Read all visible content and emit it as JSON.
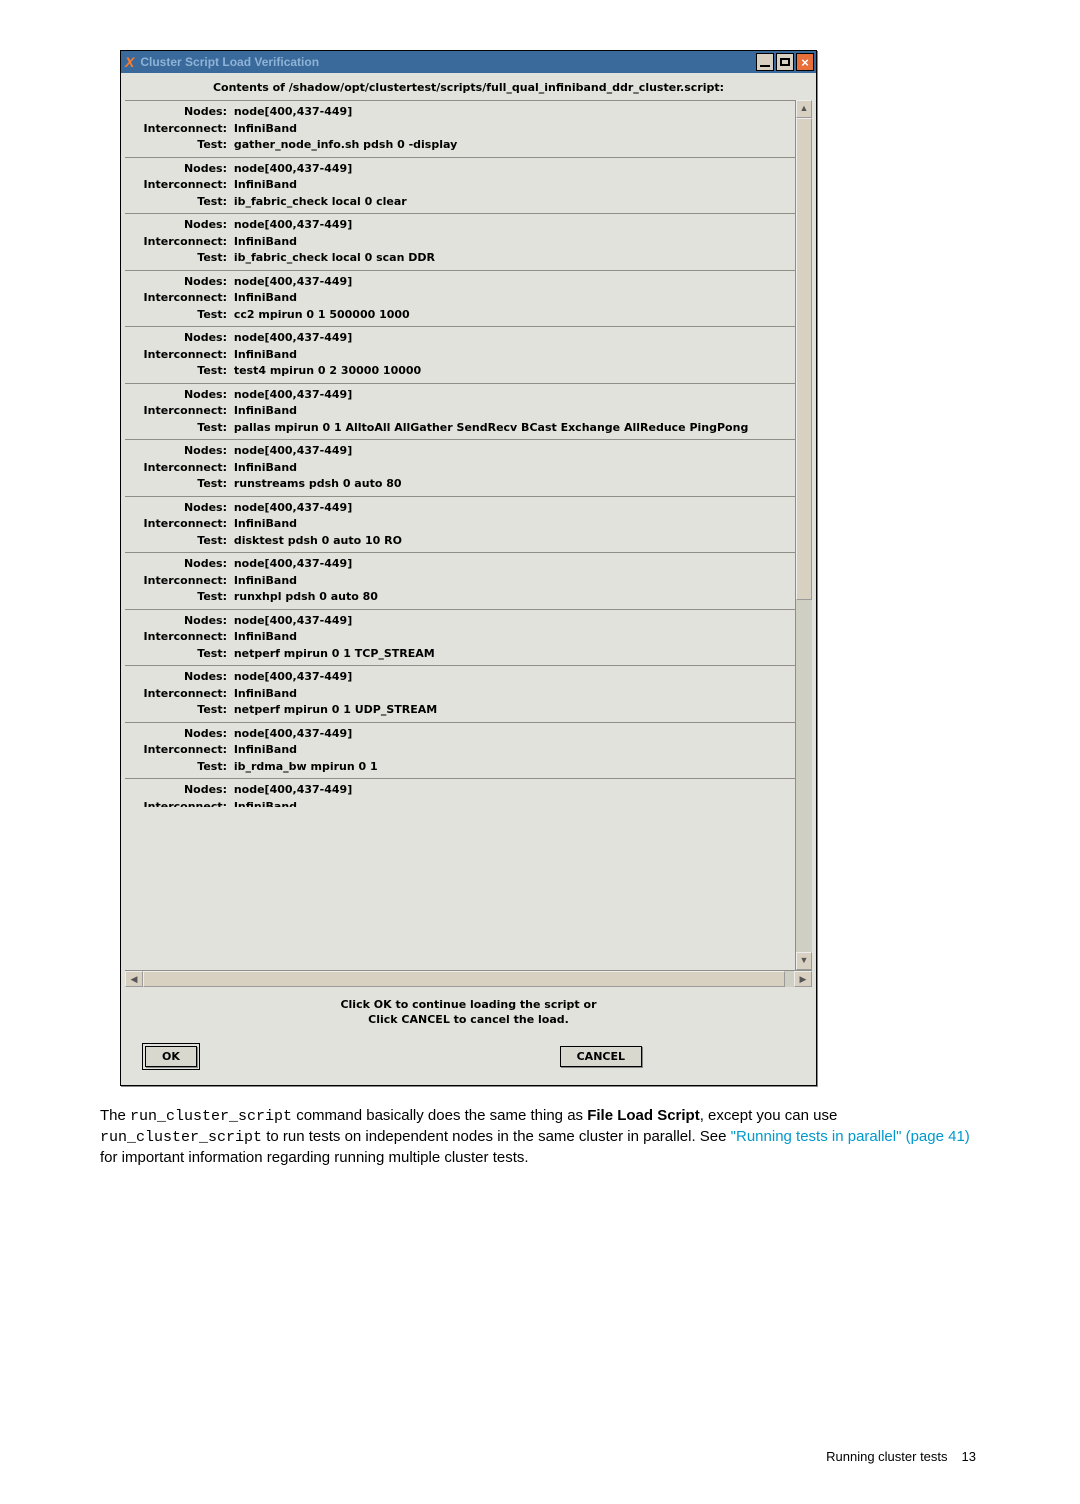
{
  "window": {
    "title": "Cluster Script Load Verification",
    "contents_heading": "Contents of /shadow/opt/clustertest/scripts/full_qual_infiniband_ddr_cluster.script:",
    "prompt_line1": "Click OK to continue loading the script or",
    "prompt_line2": "Click CANCEL to cancel the load.",
    "ok_label": "OK",
    "cancel_label": "CANCEL"
  },
  "labels": {
    "nodes": "Nodes:",
    "interconnect": "Interconnect:",
    "test": "Test:"
  },
  "entries": [
    {
      "nodes": "node[400,437-449]",
      "interconnect": "InfiniBand",
      "test": "gather_node_info.sh pdsh 0 -display"
    },
    {
      "nodes": "node[400,437-449]",
      "interconnect": "InfiniBand",
      "test": "ib_fabric_check local 0 clear"
    },
    {
      "nodes": "node[400,437-449]",
      "interconnect": "InfiniBand",
      "test": "ib_fabric_check local 0 scan DDR"
    },
    {
      "nodes": "node[400,437-449]",
      "interconnect": "InfiniBand",
      "test": "cc2 mpirun 0 1 500000 1000"
    },
    {
      "nodes": "node[400,437-449]",
      "interconnect": "InfiniBand",
      "test": "test4 mpirun 0 2 30000 10000"
    },
    {
      "nodes": "node[400,437-449]",
      "interconnect": "InfiniBand",
      "test": "pallas mpirun 0 1 AlltoAll AllGather SendRecv BCast Exchange AllReduce PingPong"
    },
    {
      "nodes": "node[400,437-449]",
      "interconnect": "InfiniBand",
      "test": "runstreams pdsh 0 auto 80"
    },
    {
      "nodes": "node[400,437-449]",
      "interconnect": "InfiniBand",
      "test": "disktest pdsh 0 auto 10 RO"
    },
    {
      "nodes": "node[400,437-449]",
      "interconnect": "InfiniBand",
      "test": "runxhpl pdsh 0 auto 80"
    },
    {
      "nodes": "node[400,437-449]",
      "interconnect": "InfiniBand",
      "test": "netperf mpirun 0 1 TCP_STREAM"
    },
    {
      "nodes": "node[400,437-449]",
      "interconnect": "InfiniBand",
      "test": "netperf mpirun 0 1 UDP_STREAM"
    },
    {
      "nodes": "node[400,437-449]",
      "interconnect": "InfiniBand",
      "test": "ib_rdma_bw mpirun 0 1"
    }
  ],
  "partial_entry": {
    "nodes": "node[400,437-449]",
    "interconnect": "InfiniBand"
  },
  "body": {
    "pre_cmd": "The ",
    "cmd1": "run_cluster_script",
    "mid1": " command basically does the same thing as ",
    "bold1": "File Load Script",
    "mid2": ", except you can use ",
    "cmd2": "run_cluster_script",
    "mid3": " to run tests on independent nodes in the same cluster in parallel. See ",
    "link": "\"Running tests in parallel\" (page 41)",
    "post": " for important information regarding running multiple cluster tests."
  },
  "footer": {
    "text": "Running cluster tests",
    "page": "13"
  }
}
